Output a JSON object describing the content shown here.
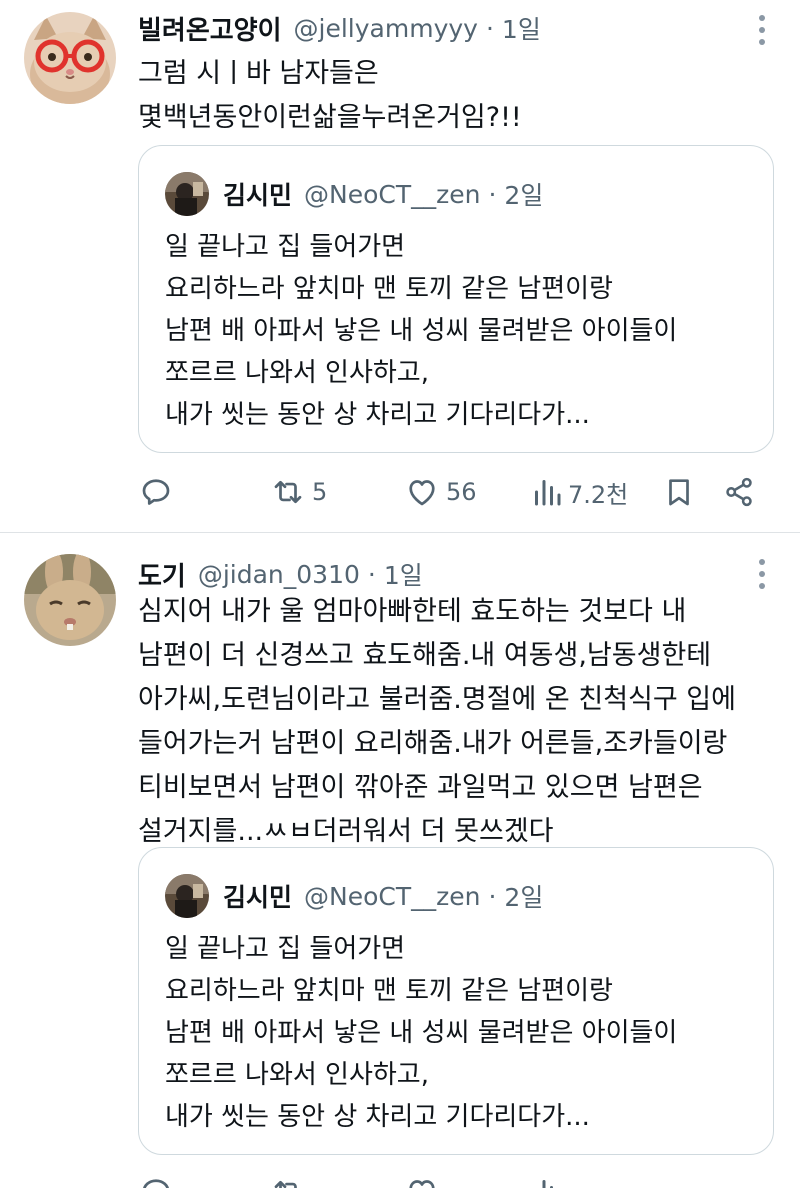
{
  "tweets": [
    {
      "name": "빌려온고양이",
      "handle": "@jellyammyyy",
      "time": "1일",
      "lines": [
        "그럼 시ㅣ바 남자들은",
        "몇백년동안이런삶을누려온거임?!!"
      ],
      "quote": {
        "name": "김시민",
        "handle": "@NeoCT__zen",
        "time": "2일",
        "lines": [
          "일 끝나고 집 들어가면",
          "요리하느라 앞치마 맨 토끼 같은 남편이랑",
          "남편 배 아파서 낳은 내 성씨 물려받은 아이들이",
          "쪼르르 나와서 인사하고,",
          "내가 씻는 동안 상 차리고 기다리다가..."
        ]
      },
      "actions": {
        "reply": "",
        "retweet": "5",
        "like": "56",
        "views": "7.2천"
      }
    },
    {
      "name": "도기",
      "handle": "@jidan_0310",
      "time": "1일",
      "lines": [
        "심지어 내가 울 엄마아빠한테 효도하는 것보다 내",
        "남편이 더 신경쓰고 효도해줌.내 여동생,남동생한테",
        "아가씨,도련님이라고 불러줌.명절에 온 친척식구 입에",
        "들어가는거 남편이 요리해줌.내가 어른들,조카들이랑",
        "티비보면서 남편이 깎아준 과일먹고 있으면 남편은",
        "설거지를...ㅆㅂ더러워서 더 못쓰겠다"
      ],
      "quote": {
        "name": "김시민",
        "handle": "@NeoCT__zen",
        "time": "2일",
        "lines": [
          "일 끝나고 집 들어가면",
          "요리하느라 앞치마 맨 토끼 같은 남편이랑",
          "남편 배 아파서 낳은 내 성씨 물려받은 아이들이",
          "쪼르르 나와서 인사하고,",
          "내가 씻는 동안 상 차리고 기다리다가..."
        ]
      }
    }
  ],
  "separator": "·",
  "icons": [
    "more-icon",
    "reply-icon",
    "retweet-icon",
    "like-icon",
    "views-icon",
    "bookmark-icon",
    "share-icon"
  ],
  "colors": {
    "text": "#0f1419",
    "muted": "#536471",
    "border": "#cfd9de"
  }
}
